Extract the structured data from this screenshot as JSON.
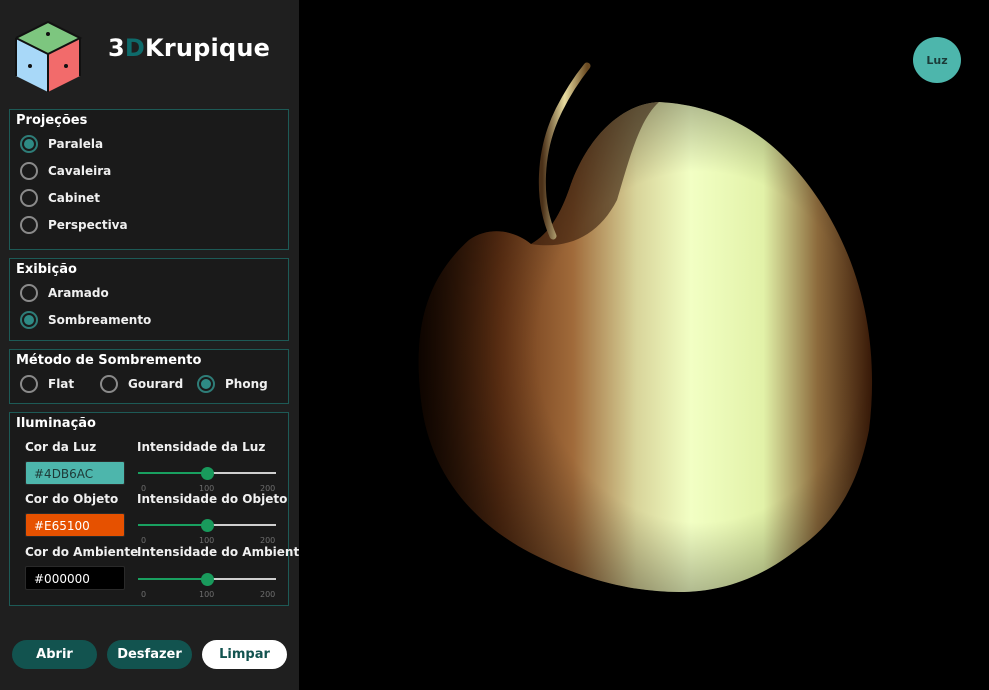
{
  "app": {
    "title_prefix": "3",
    "title_d": "D",
    "title_rest": "Krupique"
  },
  "projections": {
    "title": "Projeções",
    "options": [
      "Paralela",
      "Cavaleira",
      "Cabinet",
      "Perspectiva"
    ],
    "selected": "Paralela"
  },
  "display": {
    "title": "Exibição",
    "options": [
      "Aramado",
      "Sombreamento"
    ],
    "selected": "Sombreamento"
  },
  "shading": {
    "title": "Método de Sombremento",
    "options": [
      "Flat",
      "Gourard",
      "Phong"
    ],
    "selected": "Phong"
  },
  "lighting": {
    "title": "Iluminação",
    "light_color_label": "Cor da Luz",
    "light_color": "#4DB6AC",
    "light_intensity_label": "Intensidade da Luz",
    "light_intensity": 100,
    "object_color_label": "Cor do Objeto",
    "object_color": "#E65100",
    "object_intensity_label": "Intensidade do Objeto",
    "object_intensity": 100,
    "ambient_color_label": "Cor do Ambiente",
    "ambient_color": "#000000",
    "ambient_intensity_label": "Intensidade do Ambiente",
    "ambient_intensity": 100,
    "slider_min": "0",
    "slider_mid": "100",
    "slider_max": "200"
  },
  "buttons": {
    "open": "Abrir",
    "undo": "Desfazer",
    "clear": "Limpar"
  },
  "viewport": {
    "light_button": "Luz"
  },
  "colors": {
    "accent": "#12534F",
    "radio_accent": "#2E8B85",
    "slider_accent": "#199A5C",
    "panel_border": "#1D5A56",
    "light_button": "#4DB6AC"
  }
}
